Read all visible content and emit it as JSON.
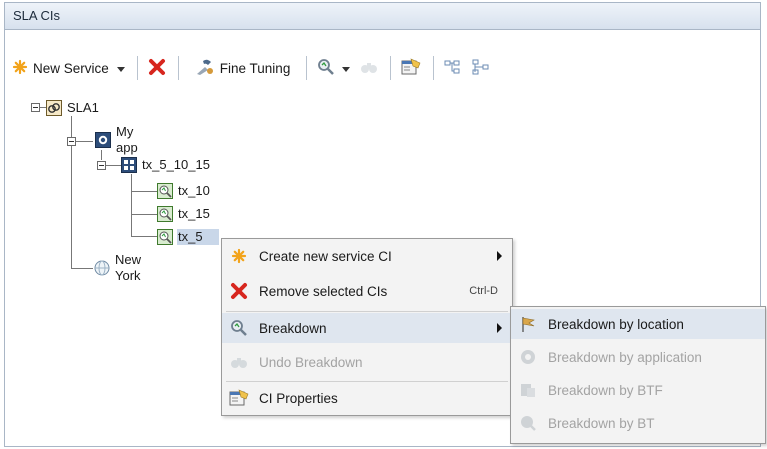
{
  "panel": {
    "title": "SLA CIs"
  },
  "toolbar": {
    "new_service_label": "New Service",
    "fine_tuning_label": "Fine Tuning"
  },
  "tree": {
    "root": "SLA1",
    "app": "My app",
    "group": "tx_5_10_15",
    "tx1": "tx_10",
    "tx2": "tx_15",
    "tx3": "tx_5",
    "location": "New York"
  },
  "context_menu": {
    "items": [
      {
        "label": "Create new service CI",
        "shortcut": ""
      },
      {
        "label": "Remove selected CIs",
        "shortcut": "Ctrl-D"
      },
      {
        "label": "Breakdown",
        "shortcut": ""
      },
      {
        "label": "Undo Breakdown",
        "shortcut": ""
      },
      {
        "label": "CI Properties",
        "shortcut": ""
      }
    ]
  },
  "submenu": {
    "items": [
      {
        "label": "Breakdown by location"
      },
      {
        "label": "Breakdown by application"
      },
      {
        "label": "Breakdown by BTF"
      },
      {
        "label": "Breakdown by BT"
      }
    ]
  },
  "colors": {
    "accent_orange": "#f2a31b",
    "remove_red": "#d7261e",
    "selection": "#c9d7e9"
  }
}
